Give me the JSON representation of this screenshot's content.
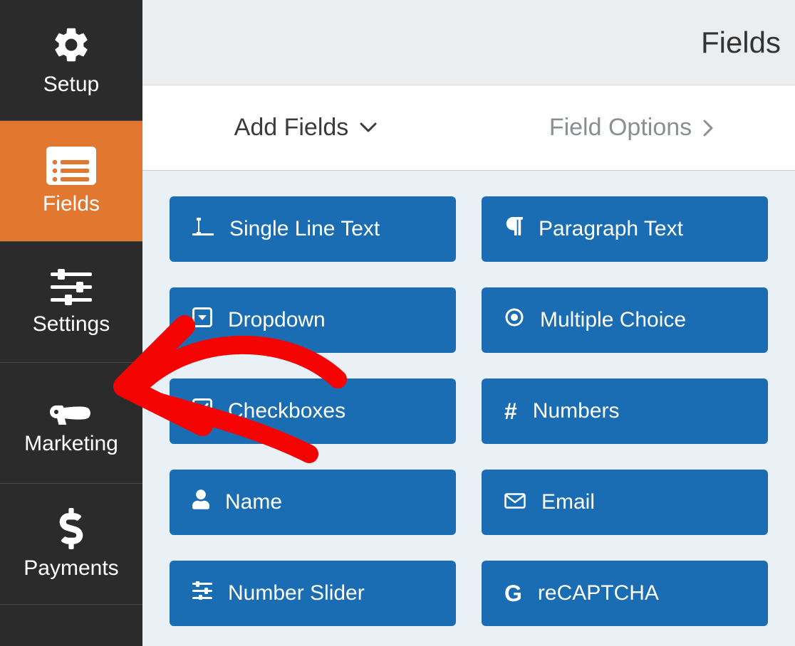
{
  "sidebar": {
    "items": [
      {
        "id": "setup",
        "label": "Setup",
        "icon": "gear-icon",
        "active": false
      },
      {
        "id": "fields",
        "label": "Fields",
        "icon": "list-icon",
        "active": true
      },
      {
        "id": "settings",
        "label": "Settings",
        "icon": "sliders-icon",
        "active": false
      },
      {
        "id": "marketing",
        "label": "Marketing",
        "icon": "bullhorn-icon",
        "active": false
      },
      {
        "id": "payments",
        "label": "Payments",
        "icon": "dollar-icon",
        "active": false
      }
    ]
  },
  "header": {
    "title": "Fields"
  },
  "tabs": [
    {
      "id": "add-fields",
      "label": "Add Fields",
      "active": true,
      "chevron": "down"
    },
    {
      "id": "field-options",
      "label": "Field Options",
      "active": false,
      "chevron": "right"
    }
  ],
  "field_tiles": [
    {
      "id": "single-line-text",
      "label": "Single Line Text",
      "icon": "text-cursor-icon"
    },
    {
      "id": "paragraph-text",
      "label": "Paragraph Text",
      "icon": "pilcrow-icon"
    },
    {
      "id": "dropdown",
      "label": "Dropdown",
      "icon": "caret-down-square-icon"
    },
    {
      "id": "multiple-choice",
      "label": "Multiple Choice",
      "icon": "radio-dot-icon"
    },
    {
      "id": "checkboxes",
      "label": "Checkboxes",
      "icon": "checkbox-checked-icon"
    },
    {
      "id": "numbers",
      "label": "Numbers",
      "icon": "hash-icon"
    },
    {
      "id": "name",
      "label": "Name",
      "icon": "user-icon"
    },
    {
      "id": "email",
      "label": "Email",
      "icon": "envelope-icon"
    },
    {
      "id": "number-slider",
      "label": "Number Slider",
      "icon": "sliders-horizontal-icon"
    },
    {
      "id": "recaptcha",
      "label": "reCAPTCHA",
      "icon": "google-g-icon"
    }
  ],
  "colors": {
    "sidebar_bg": "#2b2b2b",
    "accent_orange": "#e27730",
    "tile_blue": "#1a6db3",
    "panel_bg": "#eaf1f6",
    "annotation_red": "#f50302"
  }
}
